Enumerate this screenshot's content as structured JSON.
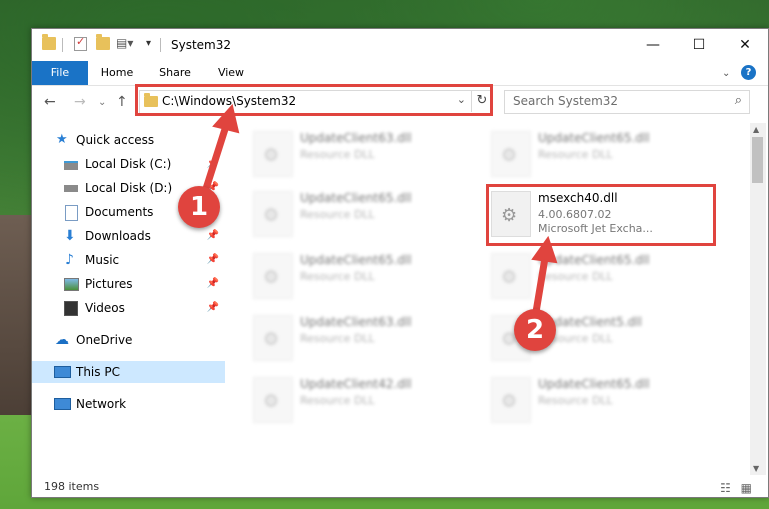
{
  "window": {
    "title": "System32",
    "min": "—",
    "max": "☐",
    "close": "✕"
  },
  "ribbon": {
    "tabs": [
      "File",
      "Home",
      "Share",
      "View"
    ],
    "help": "?"
  },
  "nav": {
    "address": "C:\\Windows\\System32",
    "search_placeholder": "Search System32"
  },
  "sidebar": {
    "items": [
      {
        "label": "Quick access",
        "icon": "star-icon"
      },
      {
        "label": "Local Disk (C:)",
        "icon": "drive-icon"
      },
      {
        "label": "Local Disk (D:)",
        "icon": "drive-icon"
      },
      {
        "label": "Documents",
        "icon": "documents-icon"
      },
      {
        "label": "Downloads",
        "icon": "downloads-icon"
      },
      {
        "label": "Music",
        "icon": "music-icon"
      },
      {
        "label": "Pictures",
        "icon": "pictures-icon"
      },
      {
        "label": "Videos",
        "icon": "videos-icon"
      },
      {
        "label": "OneDrive",
        "icon": "cloud-icon"
      },
      {
        "label": "This PC",
        "icon": "computer-icon"
      },
      {
        "label": "Network",
        "icon": "network-icon"
      }
    ]
  },
  "files": [
    {
      "name": "UpdateClient63.dll",
      "desc": "Resource DLL"
    },
    {
      "name": "UpdateClient65.dll",
      "desc": "Resource DLL"
    },
    {
      "name": "UpdateClient65.dll",
      "desc": "Resource DLL"
    },
    {
      "name": "msexch40.dll",
      "version": "4.00.6807.02",
      "desc": "Microsoft Jet Excha..."
    },
    {
      "name": "UpdateClient65.dll",
      "desc": "Resource DLL"
    },
    {
      "name": "UpdateClient65.dll",
      "desc": "Resource DLL"
    },
    {
      "name": "UpdateClient63.dll",
      "desc": "Resource DLL"
    },
    {
      "name": "UpdateClient5.dll",
      "desc": "Resource DLL"
    },
    {
      "name": "UpdateClient42.dll",
      "desc": "Resource DLL"
    },
    {
      "name": "UpdateClient65.dll",
      "desc": "Resource DLL"
    }
  ],
  "status": {
    "count": "198 items"
  },
  "annotations": {
    "step1": "1",
    "step2": "2",
    "color": "#e0443e"
  }
}
